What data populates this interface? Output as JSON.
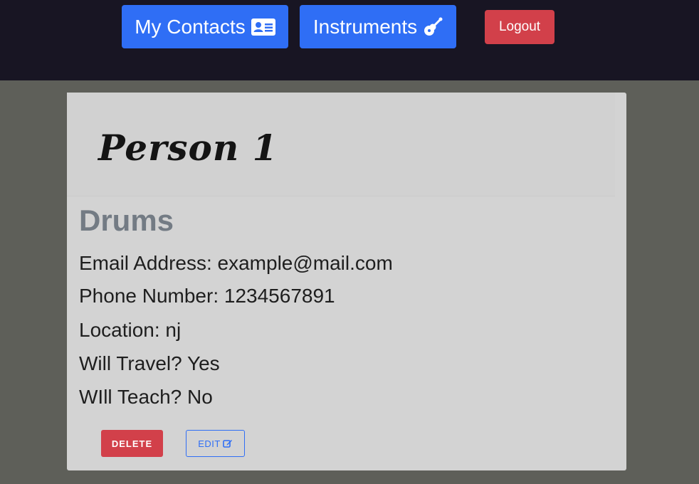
{
  "nav": {
    "contacts_label": "My Contacts",
    "contacts_icon": "id-card-icon",
    "instruments_label": "Instruments",
    "instruments_icon": "guitar-icon",
    "logout_label": "Logout"
  },
  "contact": {
    "name": "Person 1",
    "instrument": "Drums",
    "email": "Email Address: example@mail.com",
    "phone": "Phone Number: 1234567891",
    "location": "Location: nj",
    "travel": "Will Travel? Yes",
    "teach": "WIll Teach? No"
  },
  "actions": {
    "delete_label": "DELETE",
    "edit_label": "EDIT",
    "edit_icon": "edit-icon"
  },
  "colors": {
    "primary": "#2f6ef5",
    "danger": "#d2404a",
    "topbar_bg": "#181523",
    "page_bg": "#5e5f59",
    "card_bg": "#d3d3d3"
  }
}
